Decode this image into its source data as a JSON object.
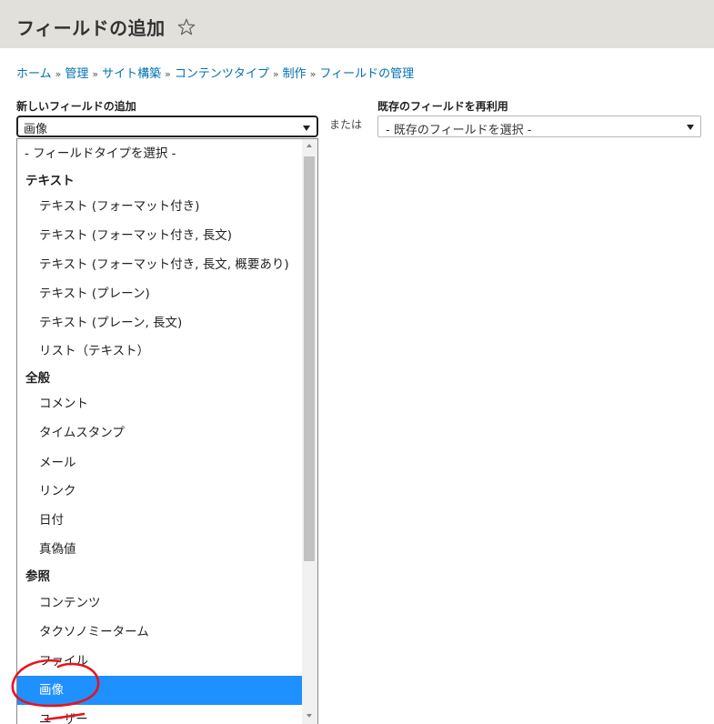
{
  "header": {
    "title": "フィールドの追加"
  },
  "breadcrumb": {
    "items": [
      "ホーム",
      "管理",
      "サイト構築",
      "コンテンツタイプ",
      "制作",
      "フィールドの管理"
    ],
    "separator": "»"
  },
  "form": {
    "new_field": {
      "label": "新しいフィールドの追加",
      "selected": "画像"
    },
    "or_text": "または",
    "existing_field": {
      "label": "既存のフィールドを再利用",
      "selected": "- 既存のフィールドを選択 -"
    }
  },
  "dropdown": {
    "placeholder": "- フィールドタイプを選択 -",
    "group_text": "テキスト",
    "text_options": [
      "テキスト (フォーマット付き)",
      "テキスト (フォーマット付き, 長文)",
      "テキスト (フォーマット付き, 長文, 概要あり)",
      "テキスト (プレーン)",
      "テキスト (プレーン, 長文)",
      "リスト（テキスト）"
    ],
    "group_general": "全般",
    "general_options": [
      "コメント",
      "タイムスタンプ",
      "メール",
      "リンク",
      "日付",
      "真偽値"
    ],
    "group_reference": "参照",
    "reference_options": [
      "コンテンツ",
      "タクソノミーターム",
      "ファイル",
      "画像",
      "ユーザー"
    ],
    "selected_option": "画像"
  },
  "colors": {
    "link": "#0071b3",
    "selected_bg": "#1e90ff",
    "annotation": "#e8131b"
  }
}
